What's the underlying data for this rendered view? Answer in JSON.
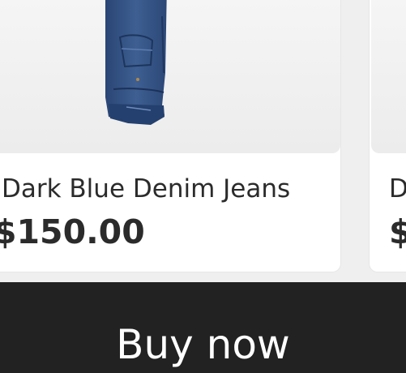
{
  "products": [
    {
      "title": "Dark Blue Denim Jeans",
      "price": "$150.00",
      "image_icon": "denim-jeans-image"
    },
    {
      "title": "D",
      "price": "$",
      "image_icon": "product-image"
    }
  ],
  "action": {
    "buy_label": "Buy now"
  },
  "colors": {
    "background": "#efefef",
    "card": "#ffffff",
    "buy_bar": "#222222",
    "buy_text": "#ffffff",
    "text": "#2b2b2b",
    "denim": "#2f4d7a"
  }
}
